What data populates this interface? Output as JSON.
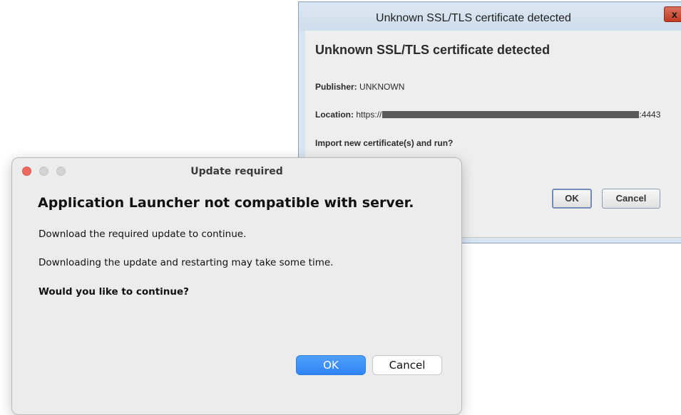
{
  "ssl_dialog": {
    "title": "Unknown SSL/TLS certificate detected",
    "close_label": "x",
    "heading": "Unknown SSL/TLS certificate detected",
    "publisher_label": "Publisher:",
    "publisher_value": "UNKNOWN",
    "location_label": "Location:",
    "location_prefix": "https://",
    "location_suffix": ":4443",
    "question": "Import new certificate(s) and run?",
    "ok_label": "OK",
    "cancel_label": "Cancel",
    "colors": {
      "frame": "#d9e4f1",
      "close": "#c23b22"
    }
  },
  "update_dialog": {
    "title": "Update required",
    "heading": "Application Launcher not compatible with server.",
    "line1": "Download the required update to continue.",
    "line2": "Downloading the update and restarting may take some time.",
    "question": "Would you like to continue?",
    "ok_label": "OK",
    "cancel_label": "Cancel",
    "colors": {
      "accent": "#3a8ef6",
      "close_dot": "#ed6a5e"
    }
  }
}
